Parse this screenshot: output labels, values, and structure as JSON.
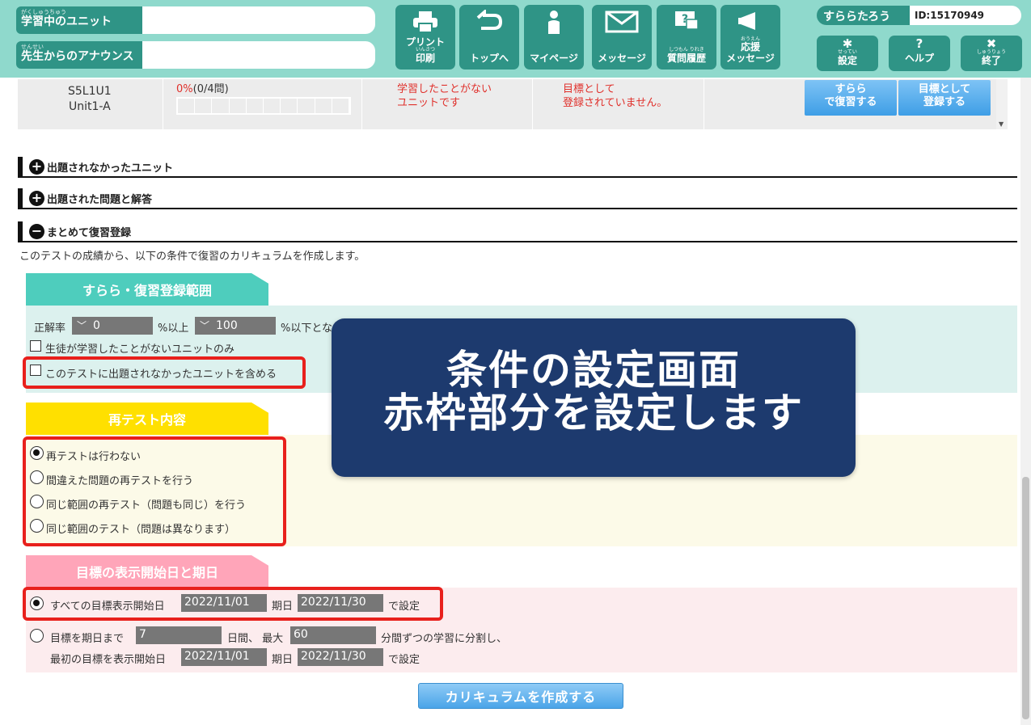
{
  "header": {
    "current_unit": {
      "ruby": "がくしゅうちゅう",
      "label": "学習中のユニット",
      "value": ""
    },
    "teacher_announce": {
      "ruby": "せんせい",
      "label": "先生からのアナウンス",
      "value": ""
    },
    "nav": [
      {
        "label": "プリント",
        "ruby": "いんさつ",
        "label2": "印刷",
        "icon": "printer-icon"
      },
      {
        "label": "トップへ",
        "icon": "back-arrow-icon"
      },
      {
        "label": "マイページ",
        "icon": "person-icon"
      },
      {
        "label": "メッセージ",
        "icon": "envelope-icon"
      },
      {
        "ruby": "しつもん りれき",
        "label": "質問履歴",
        "icon": "question-bubble-icon"
      },
      {
        "ruby": "おうえん",
        "label": "応援",
        "label2": "メッセージ",
        "icon": "megaphone-icon"
      }
    ],
    "user_name": "すららたろう",
    "user_id": "ID:15170949",
    "settings": {
      "ruby": "せってい",
      "label": "設定",
      "icon": "gear-icon"
    },
    "help": {
      "label": "ヘルプ",
      "icon": "question-icon"
    },
    "exit": {
      "ruby": "しゅうりょう",
      "label": "終了",
      "icon": "close-box-icon"
    }
  },
  "unit_row": {
    "code": "S5L1U1",
    "name": "Unit1-A",
    "progress_pct": "0%",
    "progress_detail": "(0/4問)",
    "progress_fraction": 0,
    "status_note_1": "学習したことがない",
    "status_note_2": "ユニットです",
    "goal_note_1": "目標として",
    "goal_note_2": "登録されていません。",
    "review_btn_1": "すらら",
    "review_btn_2": "で復習する",
    "goal_btn_1": "目標として",
    "goal_btn_2": "登録する"
  },
  "accordion": [
    {
      "icon": "plus-circle-icon",
      "symbol": "+",
      "label": "出題されなかったユニット"
    },
    {
      "icon": "plus-circle-icon",
      "symbol": "+",
      "label": "出題された問題と解答"
    },
    {
      "icon": "minus-circle-icon",
      "symbol": "−",
      "label": "まとめて復習登録"
    }
  ],
  "description": "このテストの成績から、以下の条件で復習のカリキュラムを作成します。",
  "section_range": {
    "title": "すらら・復習登録範囲",
    "color": "#4ecdbd",
    "rate_label": "正解率",
    "min_value": "0",
    "min_suffix": "%以上",
    "max_value": "100",
    "max_suffix": "%以下とな",
    "chk_unstudied": "生徒が学習したことがないユニットのみ",
    "chk_include_unasked": "このテストに出題されなかったユニットを含める"
  },
  "section_retest": {
    "title": "再テスト内容",
    "color": "#ffe000",
    "options": [
      {
        "label": "再テストは行わない",
        "selected": true
      },
      {
        "label": "間違えた問題の再テストを行う",
        "selected": false
      },
      {
        "label": "同じ範囲の再テスト（問題も同じ）を行う",
        "selected": false
      },
      {
        "label": "同じ範囲のテスト（問題は異なります）",
        "selected": false
      }
    ]
  },
  "section_dates": {
    "title": "目標の表示開始日と期日",
    "color": "#ffa5b9",
    "opt1_label": "すべての目標表示開始日",
    "opt1_start": "2022/11/01",
    "due_label": "期日",
    "opt1_due": "2022/11/30",
    "set_label": "で設定",
    "opt2_label": "目標を期日まで",
    "opt2_days": "7",
    "opt2_days_label": "日間、 最大",
    "opt2_minutes": "60",
    "opt2_minutes_label": "分間ずつの学習に分割し、",
    "opt2_first_label": "最初の目標を表示開始日",
    "opt2_start": "2022/11/01",
    "opt2_due": "2022/11/30"
  },
  "create_button": "カリキュラムを作成する",
  "overlay": {
    "line1": "条件の設定画面",
    "line2": "赤枠部分を設定します"
  }
}
